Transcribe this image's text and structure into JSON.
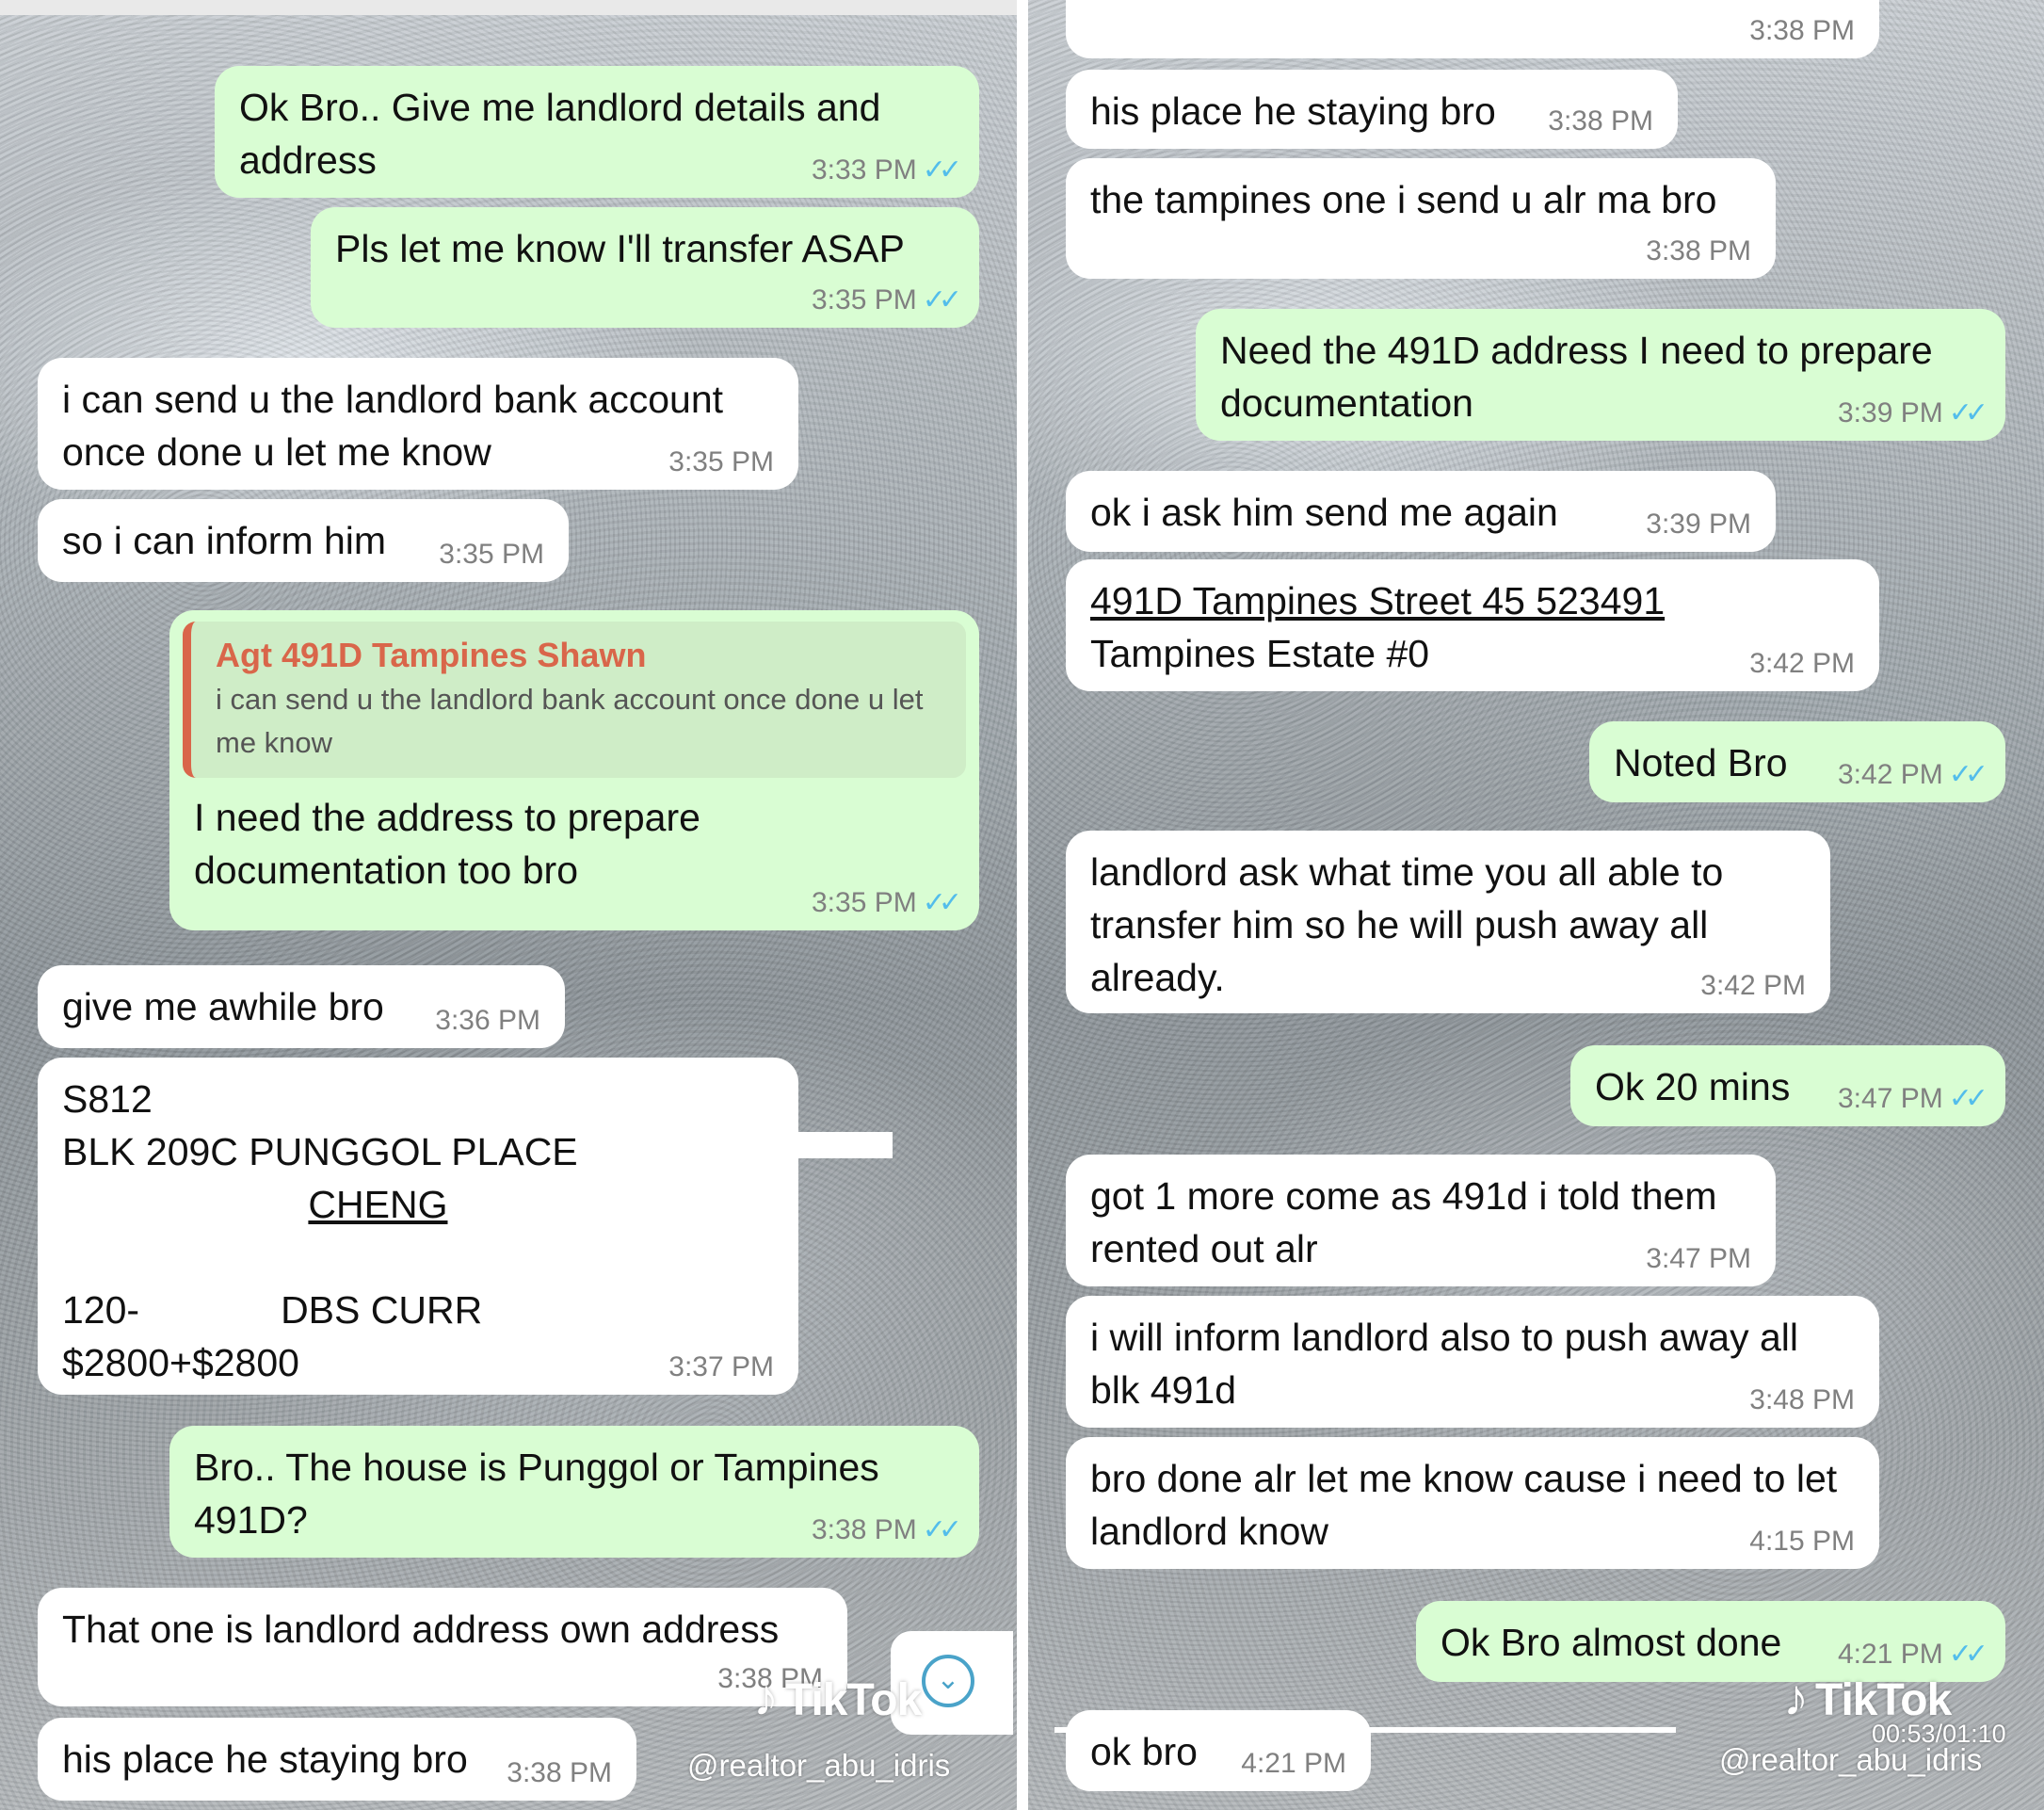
{
  "left_panel": {
    "messages": [
      {
        "text": "Ok Bro.. Give me landlord details and address",
        "time": "3:33 PM",
        "ticks": "✓✓"
      },
      {
        "text": "Pls let me know I'll transfer ASAP",
        "time": "3:35 PM",
        "ticks": "✓✓"
      },
      {
        "text": "i can send u the landlord bank account once done u let me know",
        "time": "3:35 PM"
      },
      {
        "text": "so i can inform him",
        "time": "3:35 PM"
      },
      {
        "quote_name": "Agt 491D Tampines Shawn",
        "quote_text": "i can send u the landlord bank account once done u let me know",
        "text": "I need the address to prepare documentation too bro",
        "time": "3:35 PM",
        "ticks": "✓✓"
      },
      {
        "text": "give me awhile bro",
        "time": "3:36 PM"
      },
      {
        "lines": [
          "S812",
          "BLK 209C PUNGGOL PLACE",
          "CHENG",
          "120-",
          "DBS CURR",
          "$2800+$2800"
        ],
        "time": "3:37 PM"
      },
      {
        "text": "Bro.. The house is Punggol or Tampines 491D?",
        "time": "3:38 PM",
        "ticks": "✓✓"
      },
      {
        "text": "That one is landlord address own address",
        "time": "3:38 PM"
      },
      {
        "text": "his place he staying bro",
        "time": "3:38 PM"
      }
    ],
    "watermark": {
      "brand": "TikTok",
      "handle": "@realtor_abu_idris"
    },
    "scroll_icon": "chevron-down-icon"
  },
  "right_panel": {
    "messages": [
      {
        "text": "",
        "time": "3:38 PM"
      },
      {
        "text": "his place he staying bro",
        "time": "3:38 PM"
      },
      {
        "text": "the tampines one i send u alr ma bro",
        "time": "3:38 PM"
      },
      {
        "text": "Need the 491D address I need to prepare documentation",
        "time": "3:39 PM",
        "ticks": "✓✓"
      },
      {
        "text": "ok i ask him send me again",
        "time": "3:39 PM"
      },
      {
        "lines": [
          "491D Tampines Street 45 523491",
          "Tampines Estate #0"
        ],
        "time": "3:42 PM"
      },
      {
        "text": "Noted Bro",
        "time": "3:42 PM",
        "ticks": "✓✓"
      },
      {
        "text": "landlord ask what time you all able to transfer him so he will push away all already.",
        "time": "3:42 PM"
      },
      {
        "text": "Ok 20 mins",
        "time": "3:47 PM",
        "ticks": "✓✓"
      },
      {
        "text": "got 1 more come as 491d i told them rented out alr",
        "time": "3:47 PM"
      },
      {
        "text": "i will inform landlord also to push away all blk 491d",
        "time": "3:48 PM"
      },
      {
        "text": "bro done alr let me know cause i need to let landlord know",
        "time": "4:15 PM"
      },
      {
        "text": "Ok Bro almost done",
        "time": "4:21 PM",
        "ticks": "✓✓"
      },
      {
        "text": "ok bro",
        "time": "4:21 PM"
      }
    ],
    "watermark": {
      "brand": "TikTok",
      "handle": "@realtor_abu_idris"
    },
    "video_time": "00:53/01:10"
  }
}
